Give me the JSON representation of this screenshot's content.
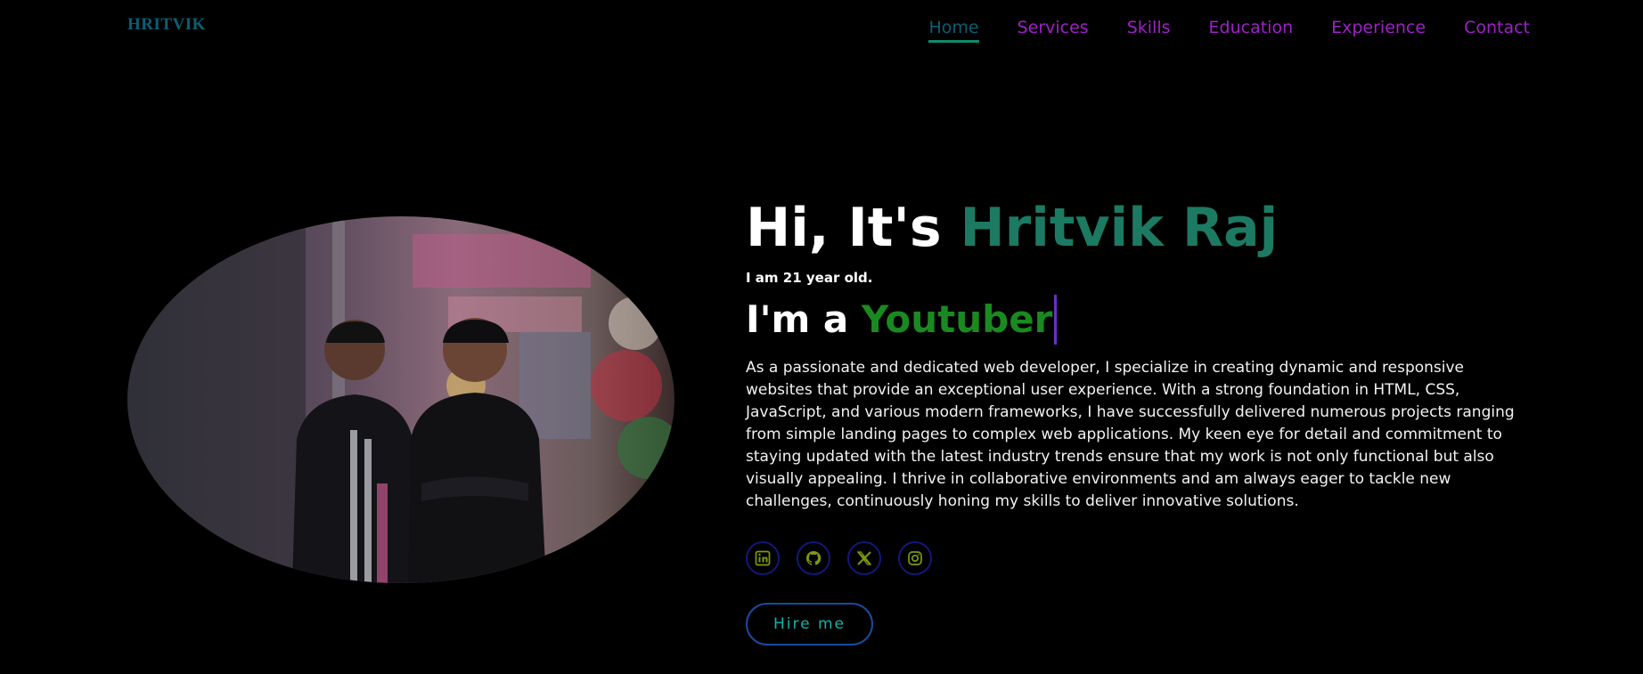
{
  "header": {
    "logo": "HRITVIK",
    "nav": [
      "Home",
      "Services",
      "Skills",
      "Education",
      "Experience",
      "Contact"
    ]
  },
  "hero": {
    "greeting_prefix": "Hi, It's ",
    "name": "Hritvik Raj",
    "age": "I am 21 year old.",
    "role_prefix": "I'm a ",
    "role": "Youtuber",
    "bio": "As a passionate and dedicated web developer, I specialize in creating dynamic and responsive websites that provide an exceptional user experience. With a strong foundation in HTML, CSS, JavaScript, and various modern frameworks, I have successfully delivered numerous projects ranging from simple landing pages to complex web applications. My keen eye for detail and commitment to staying updated with the latest industry trends ensure that my work is not only functional but also visually appealing. I thrive in collaborative environments and am always eager to tackle new challenges, continuously honing my skills to deliver innovative solutions.",
    "hire_label": "Hire me",
    "social_icons": [
      "linkedin-icon",
      "github-icon",
      "x-icon",
      "instagram-icon"
    ]
  },
  "colors": {
    "background": "#000000",
    "name_accent": "#1c7a62",
    "role_accent": "#1a8a20",
    "nav_link": "#a020c8",
    "nav_active": "#0b5f73",
    "icon_color": "#7d9a12",
    "button_text": "#16b2a5"
  }
}
